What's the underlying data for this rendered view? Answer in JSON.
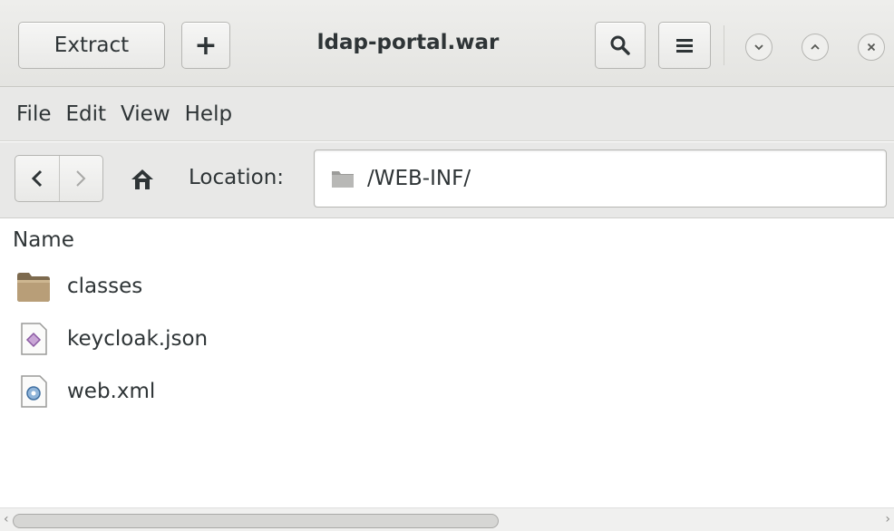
{
  "header": {
    "title": "ldap-portal.war",
    "extract_label": "Extract",
    "add_label": "+",
    "icons": {
      "search": "search-icon",
      "menu": "hamburger-menu-icon",
      "minimize": "chevron-down-icon",
      "maximize": "chevron-up-icon",
      "close": "close-icon"
    }
  },
  "menubar": {
    "items": [
      {
        "label": "File"
      },
      {
        "label": "Edit"
      },
      {
        "label": "View"
      },
      {
        "label": "Help"
      }
    ]
  },
  "location": {
    "label": "Location:",
    "value": "/WEB-INF/"
  },
  "files": {
    "column_name": "Name",
    "rows": [
      {
        "name": "classes",
        "icon": "folder-icon"
      },
      {
        "name": "keycloak.json",
        "icon": "json-file-icon"
      },
      {
        "name": "web.xml",
        "icon": "xml-file-icon"
      }
    ]
  },
  "colors": {
    "folder": "#a08a6a",
    "headerbar": "#e6e6e4",
    "text": "#2e3436"
  }
}
